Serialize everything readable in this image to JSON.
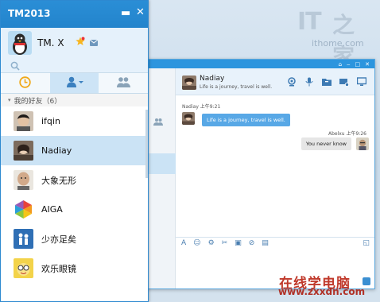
{
  "background_logo": {
    "brand": "IT",
    "cn": "之家",
    "url": "ithome.com"
  },
  "panel": {
    "title": "TM2013",
    "profile_name": "TM. X",
    "group_label": "我的好友（6）",
    "contacts": [
      {
        "name": "ifqin",
        "avatar": "avatar-dark-hair"
      },
      {
        "name": "Nadiay",
        "avatar": "avatar-woman"
      },
      {
        "name": "大象无形",
        "avatar": "avatar-bald-man"
      },
      {
        "name": "AIGA",
        "avatar": "avatar-colorful-hexagon"
      },
      {
        "name": "少亦足矣",
        "avatar": "avatar-figures"
      },
      {
        "name": "欢乐眼镜",
        "avatar": "avatar-glasses-cartoon"
      }
    ],
    "tabs": [
      "recent-icon",
      "contacts-icon",
      "groups-icon"
    ]
  },
  "chat": {
    "contact_name": "Nadiay",
    "contact_status": "Life is a journey, travel is well.",
    "messages": [
      {
        "sender": "Nadiay",
        "time": "上午9:21",
        "text": "Life is a journey, travel is well.",
        "side": "in"
      },
      {
        "sender": "Abelxu",
        "time": "上午9:26",
        "text": "You never know",
        "side": "out"
      }
    ]
  },
  "watermark": {
    "line1": "在线学电脑",
    "line2": "www.zxxdn.com"
  },
  "colors": {
    "accent": "#2a8ed6",
    "bubble_in": "#58a8e6",
    "selected": "#cbe3f5",
    "watermark": "#c0392b"
  }
}
